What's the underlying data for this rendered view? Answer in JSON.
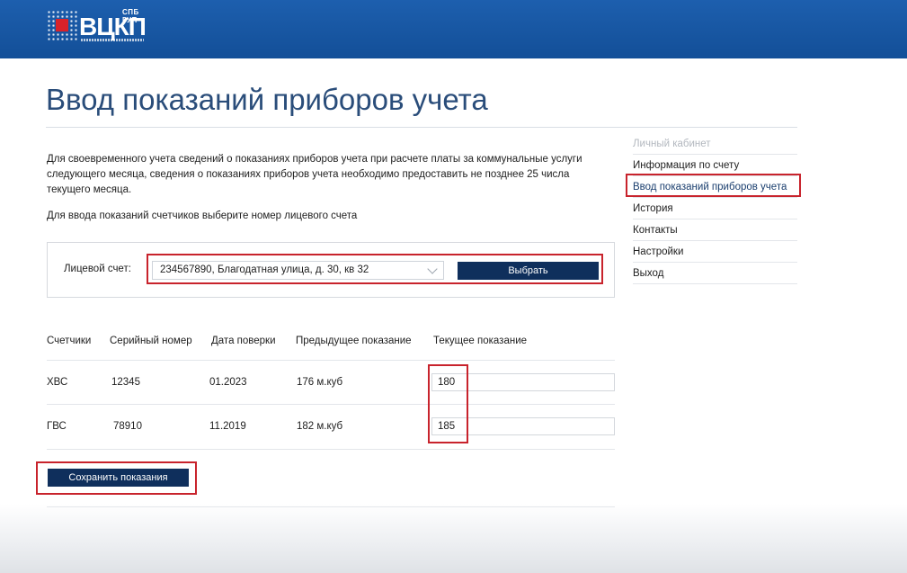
{
  "header": {
    "logo_top": "СПБ ГУП",
    "logo_main": "ВЦКП",
    "brand_color": "#134f98"
  },
  "page": {
    "title": "Ввод показаний приборов учета",
    "intro_1": "Для своевременного учета сведений о показаниях приборов учета при расчете платы за коммунальные услуги следующего месяца, сведения о показаниях приборов учета необходимо предоставить не позднее 25 числа текущего месяца.",
    "intro_2": "Для ввода показаний счетчиков выберите номер лицевого счета"
  },
  "account": {
    "label": "Лицевой счет:",
    "selected": "234567890, Благодатная улица, д. 30, кв 32",
    "choose_label": "Выбрать"
  },
  "sidebar": {
    "items": [
      {
        "label": "Личный кабинет"
      },
      {
        "label": "Информация по счету"
      },
      {
        "label": "Ввод показаний приборов учета"
      },
      {
        "label": "История"
      },
      {
        "label": "Контакты"
      },
      {
        "label": "Настройки"
      },
      {
        "label": "Выход"
      }
    ]
  },
  "table": {
    "headers": [
      "Счетчики",
      "Серийный номер",
      "Дата поверки",
      "Предыдущее показание",
      "Текущее показание"
    ],
    "rows": [
      {
        "meter": "ХВС",
        "serial": "12345",
        "date": "01.2023",
        "previous": "176 м.куб",
        "current": "180"
      },
      {
        "meter": "ГВС",
        "serial": "78910",
        "date": "11.2019",
        "previous": "182 м.куб",
        "current": "185"
      }
    ]
  },
  "actions": {
    "save_label": "Сохранить показания"
  },
  "colors": {
    "button": "#0f2f5c",
    "highlight": "#c8232c",
    "title": "#2a4d7a"
  }
}
